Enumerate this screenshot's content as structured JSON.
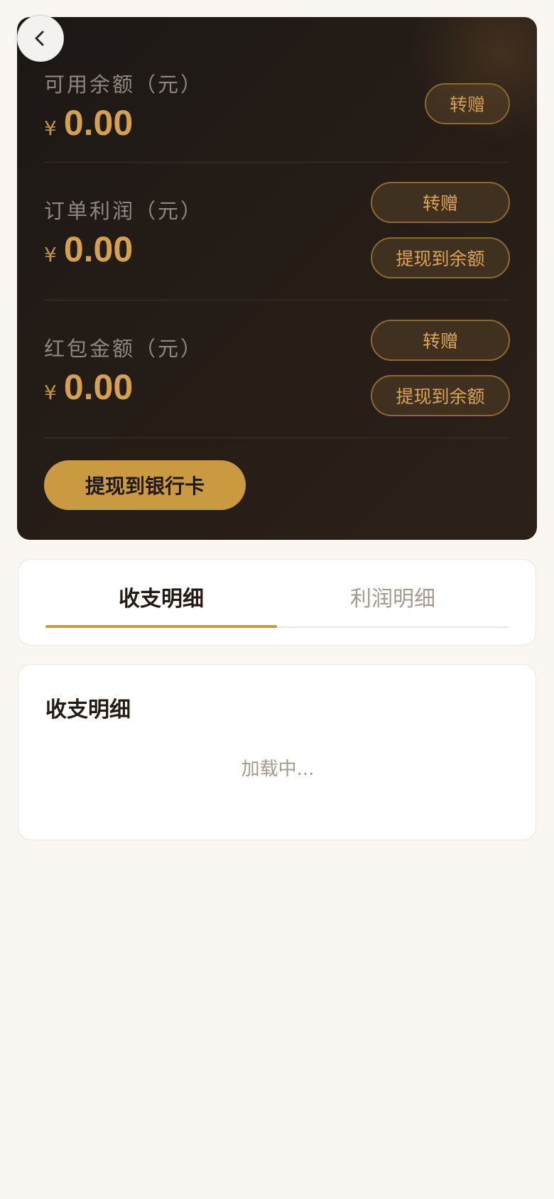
{
  "header": {
    "back_icon": "chevron-left-icon"
  },
  "wallet": {
    "currency_symbol": "¥",
    "available": {
      "label": "可用余额（元）",
      "amount": "0.00",
      "transfer_label": "转赠"
    },
    "order_profit": {
      "label": "订单利润（元）",
      "amount": "0.00",
      "transfer_label": "转赠",
      "withdraw_label": "提现到余额"
    },
    "red_packet": {
      "label": "红包金额（元）",
      "amount": "0.00",
      "transfer_label": "转赠",
      "withdraw_label": "提现到余额"
    },
    "bank_withdraw_label": "提现到银行卡"
  },
  "tabs": [
    {
      "label": "收支明细",
      "active": true
    },
    {
      "label": "利润明细",
      "active": false
    }
  ],
  "list": {
    "title": "收支明细",
    "loading_text": "加载中..."
  },
  "colors": {
    "accent": "#c99a3f",
    "card_dark": "#241c16",
    "page_bg": "#faf7f2"
  }
}
